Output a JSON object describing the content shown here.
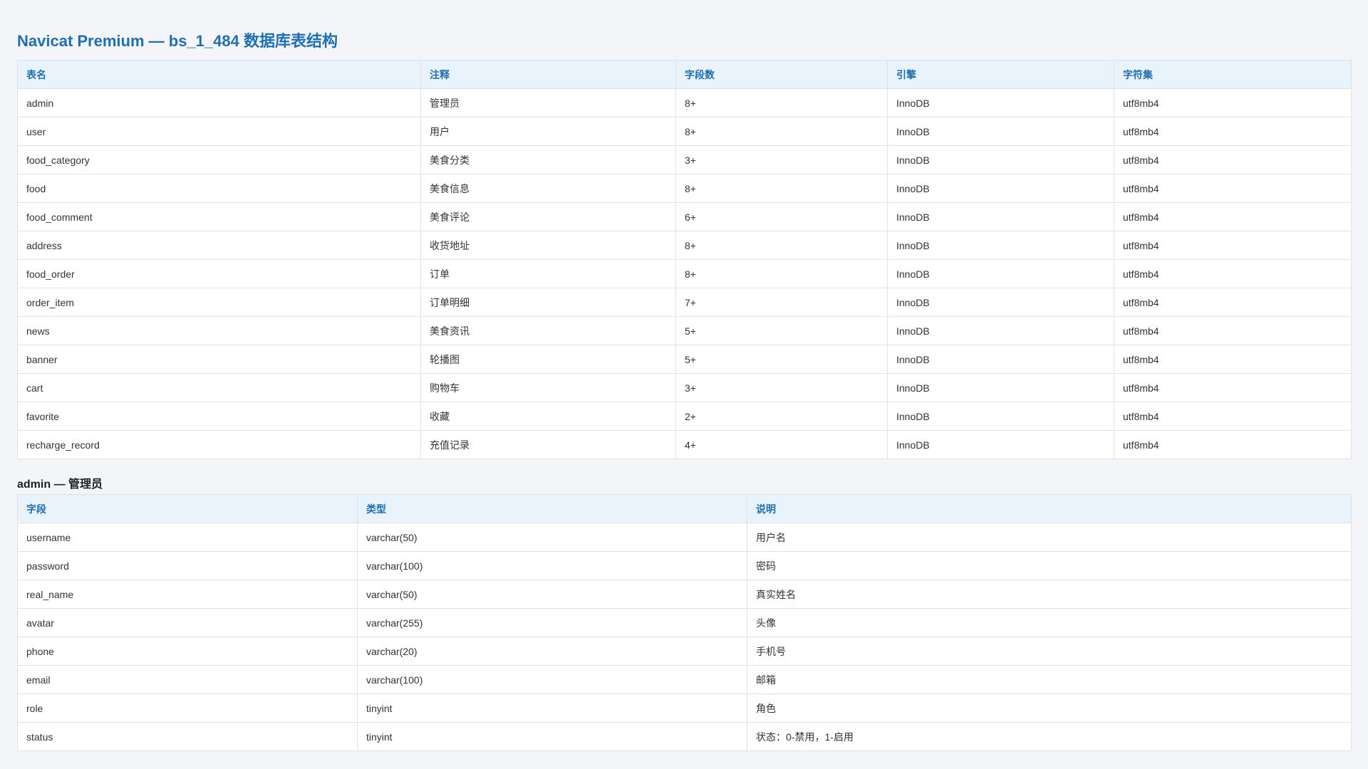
{
  "page": {
    "title": "Navicat Premium — bs_1_484 数据库表结构"
  },
  "tables_overview": {
    "headers": [
      "表名",
      "注释",
      "字段数",
      "引擎",
      "字符集"
    ],
    "rows": [
      [
        "admin",
        "管理员",
        "8+",
        "InnoDB",
        "utf8mb4"
      ],
      [
        "user",
        "用户",
        "8+",
        "InnoDB",
        "utf8mb4"
      ],
      [
        "food_category",
        "美食分类",
        "3+",
        "InnoDB",
        "utf8mb4"
      ],
      [
        "food",
        "美食信息",
        "8+",
        "InnoDB",
        "utf8mb4"
      ],
      [
        "food_comment",
        "美食评论",
        "6+",
        "InnoDB",
        "utf8mb4"
      ],
      [
        "address",
        "收货地址",
        "8+",
        "InnoDB",
        "utf8mb4"
      ],
      [
        "food_order",
        "订单",
        "8+",
        "InnoDB",
        "utf8mb4"
      ],
      [
        "order_item",
        "订单明细",
        "7+",
        "InnoDB",
        "utf8mb4"
      ],
      [
        "news",
        "美食资讯",
        "5+",
        "InnoDB",
        "utf8mb4"
      ],
      [
        "banner",
        "轮播图",
        "5+",
        "InnoDB",
        "utf8mb4"
      ],
      [
        "cart",
        "购物车",
        "3+",
        "InnoDB",
        "utf8mb4"
      ],
      [
        "favorite",
        "收藏",
        "2+",
        "InnoDB",
        "utf8mb4"
      ],
      [
        "recharge_record",
        "充值记录",
        "4+",
        "InnoDB",
        "utf8mb4"
      ]
    ]
  },
  "admin_section": {
    "heading": "admin — 管理员",
    "headers": [
      "字段",
      "类型",
      "说明"
    ],
    "rows": [
      [
        "username",
        "varchar(50)",
        "用户名"
      ],
      [
        "password",
        "varchar(100)",
        "密码"
      ],
      [
        "real_name",
        "varchar(50)",
        "真实姓名"
      ],
      [
        "avatar",
        "varchar(255)",
        "头像"
      ],
      [
        "phone",
        "varchar(20)",
        "手机号"
      ],
      [
        "email",
        "varchar(100)",
        "邮箱"
      ],
      [
        "role",
        "tinyint",
        "角色"
      ],
      [
        "status",
        "tinyint",
        "状态：0-禁用，1-启用"
      ]
    ]
  },
  "colors": {
    "title": "#1f6fb2",
    "header_bg": "#e8f3fb",
    "header_text": "#1f6fb2",
    "page_bg": "#f3f5f8",
    "border": "#dfe3e8"
  }
}
